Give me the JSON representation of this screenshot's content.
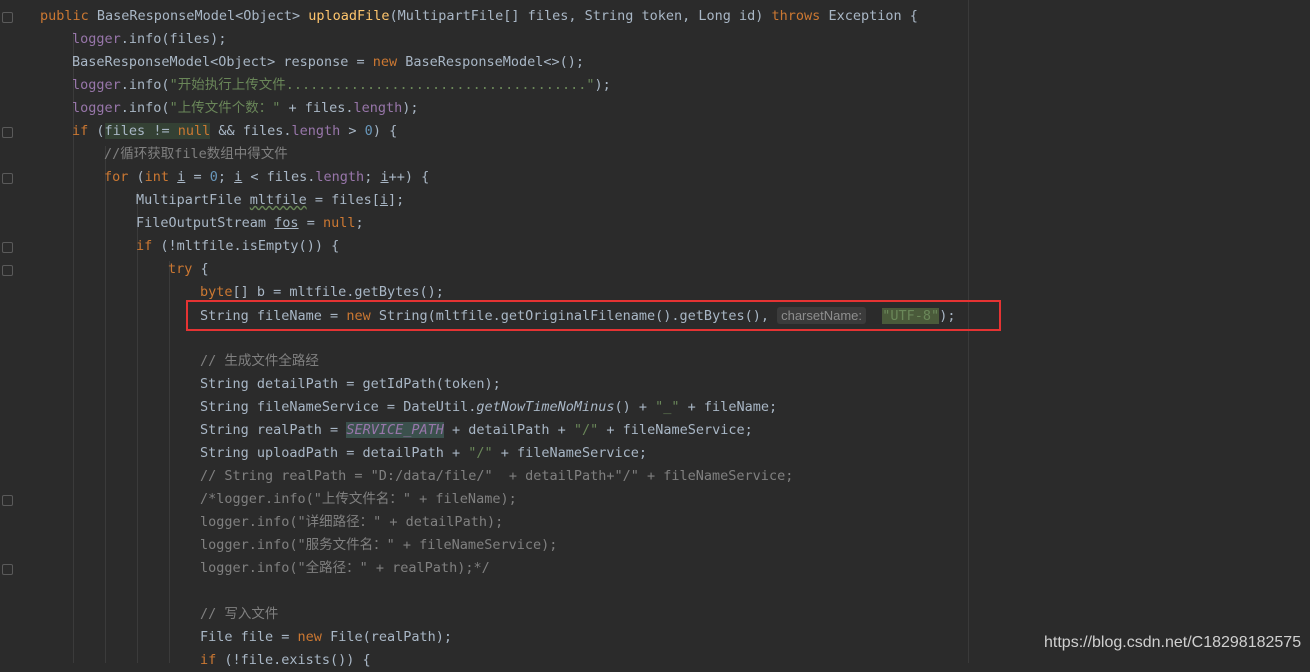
{
  "editor": {
    "lines": [
      {
        "id": "l1",
        "segments": [
          [
            "kw",
            "public "
          ],
          [
            "",
            "BaseResponseModel<Object> "
          ],
          [
            "fn",
            "uploadFile"
          ],
          [
            "",
            "(MultipartFile[] files, String token, Long id) "
          ],
          [
            "kw",
            "throws "
          ],
          [
            "",
            "Exception {"
          ]
        ]
      },
      {
        "id": "l2",
        "segments": [
          [
            "fld",
            "logger"
          ],
          [
            "",
            ".info(files);"
          ]
        ]
      },
      {
        "id": "l3",
        "segments": [
          [
            "",
            "BaseResponseModel<Object> response = "
          ],
          [
            "kw",
            "new "
          ],
          [
            "",
            "BaseResponseModel<>();"
          ]
        ]
      },
      {
        "id": "l4",
        "segments": [
          [
            "fld",
            "logger"
          ],
          [
            "",
            ".info("
          ],
          [
            "str",
            "\"开始执行上传文件.....................................\""
          ],
          [
            "",
            ");"
          ]
        ]
      },
      {
        "id": "l5",
        "segments": [
          [
            "fld",
            "logger"
          ],
          [
            "",
            ".info("
          ],
          [
            "str",
            "\"上传文件个数：\""
          ],
          [
            "",
            " + files."
          ],
          [
            "fld",
            "length"
          ],
          [
            "",
            ");"
          ]
        ]
      },
      {
        "id": "l6",
        "segments": [
          [
            "kw",
            "if "
          ],
          [
            "",
            "("
          ],
          [
            "hl",
            "files "
          ],
          [
            "hl",
            "!= "
          ],
          [
            "hlkw",
            "null"
          ],
          [
            "",
            " && files."
          ],
          [
            "fld",
            "length"
          ],
          [
            "",
            " > "
          ],
          [
            "num",
            "0"
          ],
          [
            "",
            ") {"
          ]
        ]
      },
      {
        "id": "l7",
        "segments": [
          [
            "cm",
            "//循环获取file数组中得文件"
          ]
        ]
      },
      {
        "id": "l8",
        "segments": [
          [
            "kw",
            "for "
          ],
          [
            "",
            "("
          ],
          [
            "kw",
            "int "
          ],
          [
            "ul",
            "i"
          ],
          [
            "",
            " = "
          ],
          [
            "num",
            "0"
          ],
          [
            "",
            "; "
          ],
          [
            "ul",
            "i"
          ],
          [
            "",
            " < files."
          ],
          [
            "fld",
            "length"
          ],
          [
            "",
            "; "
          ],
          [
            "ul",
            "i"
          ],
          [
            "",
            "++) {"
          ]
        ]
      },
      {
        "id": "l9",
        "segments": [
          [
            "",
            "MultipartFile "
          ],
          [
            "wavy",
            "mltfile"
          ],
          [
            "",
            " = files["
          ],
          [
            "ul",
            "i"
          ],
          [
            "",
            "];"
          ]
        ]
      },
      {
        "id": "l10",
        "segments": [
          [
            "",
            "FileOutputStream "
          ],
          [
            "ul",
            "fos"
          ],
          [
            "",
            " = "
          ],
          [
            "kw",
            "null"
          ],
          [
            "",
            ";"
          ]
        ]
      },
      {
        "id": "l11",
        "segments": [
          [
            "kw",
            "if "
          ],
          [
            "",
            "(!mltfile.isEmpty()) {"
          ]
        ]
      },
      {
        "id": "l12",
        "segments": [
          [
            "kw",
            "try "
          ],
          [
            "",
            "{"
          ]
        ]
      },
      {
        "id": "l13",
        "segments": [
          [
            "kw",
            "byte"
          ],
          [
            "",
            "[] b = mltfile.getBytes();"
          ]
        ]
      },
      {
        "id": "l14",
        "segments": [
          [
            "",
            "String fileName = "
          ],
          [
            "kw",
            "new "
          ],
          [
            "",
            "String(mltfile.getOriginalFilename().getBytes(), "
          ],
          [
            "hint",
            "charsetName:"
          ],
          [
            "",
            "  "
          ],
          [
            "hlstr",
            "\"UTF-8\""
          ],
          [
            "",
            ");"
          ]
        ]
      },
      {
        "id": "l15",
        "segments": []
      },
      {
        "id": "l16",
        "segments": [
          [
            "cm",
            "// 生成文件全路经"
          ]
        ]
      },
      {
        "id": "l17",
        "segments": [
          [
            "",
            "String detailPath = getIdPath(token);"
          ]
        ]
      },
      {
        "id": "l18",
        "segments": [
          [
            "",
            "String fileNameService = DateUtil."
          ],
          [
            "ital",
            "getNowTimeNoMinus"
          ],
          [
            "",
            "() + "
          ],
          [
            "str",
            "\"_\""
          ],
          [
            "",
            " + fileName;"
          ]
        ]
      },
      {
        "id": "l19",
        "segments": [
          [
            "",
            "String realPath = "
          ],
          [
            "statbox",
            "SERVICE_PATH"
          ],
          [
            "",
            " + detailPath + "
          ],
          [
            "str",
            "\"/\""
          ],
          [
            "",
            " + fileNameService;"
          ]
        ]
      },
      {
        "id": "l20",
        "segments": [
          [
            "",
            "String uploadPath = detailPath + "
          ],
          [
            "str",
            "\"/\""
          ],
          [
            "",
            " + fileNameService;"
          ]
        ]
      },
      {
        "id": "l21",
        "segments": [
          [
            "cm",
            "// String realPath = \"D:/data/file/\"  + detailPath+\"/\" + fileNameService;"
          ]
        ]
      },
      {
        "id": "l22",
        "segments": [
          [
            "cm",
            "/*logger.info(\"上传文件名：\" + fileName);"
          ]
        ]
      },
      {
        "id": "l23",
        "segments": [
          [
            "cm",
            "logger.info(\"详细路径：\" + detailPath);"
          ]
        ]
      },
      {
        "id": "l24",
        "segments": [
          [
            "cm",
            "logger.info(\"服务文件名：\" + fileNameService);"
          ]
        ]
      },
      {
        "id": "l25",
        "segments": [
          [
            "cm",
            "logger.info(\"全路径：\" + realPath);*/"
          ]
        ]
      },
      {
        "id": "l26",
        "segments": []
      },
      {
        "id": "l27",
        "segments": [
          [
            "cm",
            "// 写入文件"
          ]
        ]
      },
      {
        "id": "l28",
        "segments": [
          [
            "",
            "File file = "
          ],
          [
            "kw",
            "new "
          ],
          [
            "",
            "File(realPath);"
          ]
        ]
      },
      {
        "id": "l29",
        "segments": [
          [
            "kw",
            "if "
          ],
          [
            "",
            "(!file.exists()) {"
          ]
        ]
      }
    ]
  },
  "watermark": "https://blog.csdn.net/C18298182575",
  "colors": {
    "background": "#2b2b2b",
    "keyword": "#cc7832",
    "method": "#ffc66d",
    "string": "#6a8759",
    "field": "#9876aa",
    "comment": "#808080",
    "highlight_box": "#e53333"
  }
}
